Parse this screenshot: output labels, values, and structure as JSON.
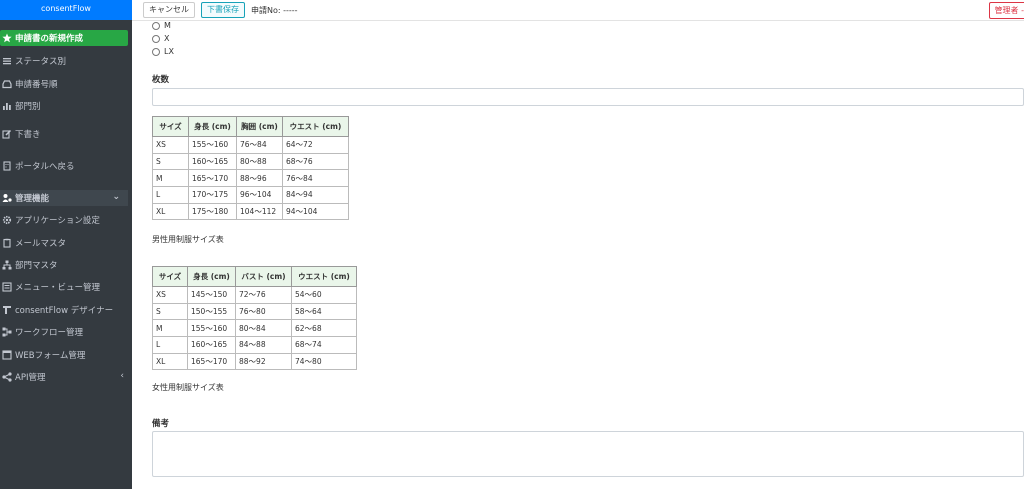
{
  "brand": "consentFlow",
  "sidebar": {
    "items": [
      {
        "label": "申請書の新規作成",
        "icon": "star-icon",
        "name": "sidebar-item-new-application"
      },
      {
        "label": "ステータス別",
        "icon": "list-icon",
        "name": "sidebar-item-by-status"
      },
      {
        "label": "申請番号順",
        "icon": "inbox-icon",
        "name": "sidebar-item-by-number"
      },
      {
        "label": "部門別",
        "icon": "bar-chart-icon",
        "name": "sidebar-item-by-department"
      },
      {
        "label": "下書き",
        "icon": "edit-icon",
        "name": "sidebar-item-drafts"
      },
      {
        "label": "ポータルへ戻る",
        "icon": "building-icon",
        "name": "sidebar-item-back-to-portal"
      },
      {
        "label": "管理機能",
        "icon": "users-cog-icon",
        "name": "sidebar-item-admin"
      },
      {
        "label": "アプリケーション設定",
        "icon": "gear-icon",
        "name": "sidebar-item-app-settings"
      },
      {
        "label": "メールマスタ",
        "icon": "clipboard-icon",
        "name": "sidebar-item-mail-master"
      },
      {
        "label": "部門マスタ",
        "icon": "sitemap-icon",
        "name": "sidebar-item-department-master"
      },
      {
        "label": "メニュー・ビュー管理",
        "icon": "menu-list-icon",
        "name": "sidebar-item-menu-view"
      },
      {
        "label": "consentFlow デザイナー",
        "icon": "designer-icon",
        "name": "sidebar-item-designer"
      },
      {
        "label": "ワークフロー管理",
        "icon": "workflow-icon",
        "name": "sidebar-item-workflow"
      },
      {
        "label": "WEBフォーム管理",
        "icon": "form-icon",
        "name": "sidebar-item-web-form"
      },
      {
        "label": "API管理",
        "icon": "share-icon",
        "name": "sidebar-item-api"
      }
    ],
    "admin_caret": "⌄",
    "api_caret": "‹"
  },
  "toolbar": {
    "cancel_label": "キャンセル",
    "draft_label": "下書保存",
    "app_no": "申請No: -----",
    "admin_label": "管理者 -"
  },
  "form": {
    "options": [
      "M",
      "X",
      "LX"
    ],
    "count_label": "枚数",
    "count_value": "",
    "remarks_label": "備考",
    "remarks_value": ""
  },
  "men_table": {
    "headers": [
      "サイズ",
      "身長 (cm)",
      "胸囲 (cm)",
      "ウエスト (cm)"
    ],
    "rows": [
      [
        "XS",
        "155～160",
        "76～84",
        "64～72"
      ],
      [
        "S",
        "160～165",
        "80～88",
        "68～76"
      ],
      [
        "M",
        "165～170",
        "88～96",
        "76～84"
      ],
      [
        "L",
        "170～175",
        "96～104",
        "84～94"
      ],
      [
        "XL",
        "175～180",
        "104～112",
        "94～104"
      ]
    ],
    "caption": "男性用制服サイズ表"
  },
  "women_table": {
    "headers": [
      "サイズ",
      "身長 (cm)",
      "バスト (cm)",
      "ウエスト (cm)"
    ],
    "rows": [
      [
        "XS",
        "145～150",
        "72～76",
        "54～60"
      ],
      [
        "S",
        "150～155",
        "76～80",
        "58～64"
      ],
      [
        "M",
        "155～160",
        "80～84",
        "62～68"
      ],
      [
        "L",
        "160～165",
        "84～88",
        "68～74"
      ],
      [
        "XL",
        "165～170",
        "88～92",
        "74～80"
      ]
    ],
    "caption": "女性用制服サイズ表"
  }
}
